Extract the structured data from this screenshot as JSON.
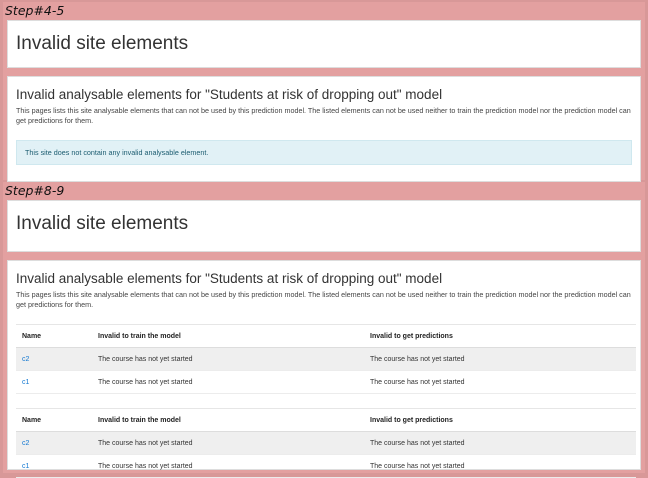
{
  "step1": {
    "label": "Step#4-5",
    "page_title": "Invalid site elements",
    "heading": "Invalid analysable elements for \"Students at risk of dropping out\" model",
    "description": "This pages lists this site analysable elements that can not be used by this prediction model. The listed elements can not be used neither to train the prediction model nor the prediction model can get predictions for them.",
    "alert": "This site does not contain any invalid analysable element."
  },
  "step2": {
    "label": "Step#8-9",
    "page_title": "Invalid site elements",
    "heading": "Invalid analysable elements for \"Students at risk of dropping out\" model",
    "description": "This pages lists this site analysable elements that can not be used by this prediction model. The listed elements can not be used neither to train the prediction model nor the prediction model can get predictions for them.",
    "tables": [
      {
        "headers": [
          "Name",
          "Invalid to train the model",
          "Invalid to get predictions"
        ],
        "rows": [
          [
            "c2",
            "The course has not yet started",
            "The course has not yet started"
          ],
          [
            "c1",
            "The course has not yet started",
            "The course has not yet started"
          ]
        ]
      },
      {
        "headers": [
          "Name",
          "Invalid to train the model",
          "Invalid to get predictions"
        ],
        "rows": [
          [
            "c2",
            "The course has not yet started",
            "The course has not yet started"
          ],
          [
            "c1",
            "The course has not yet started",
            "The course has not yet started"
          ]
        ]
      }
    ]
  }
}
